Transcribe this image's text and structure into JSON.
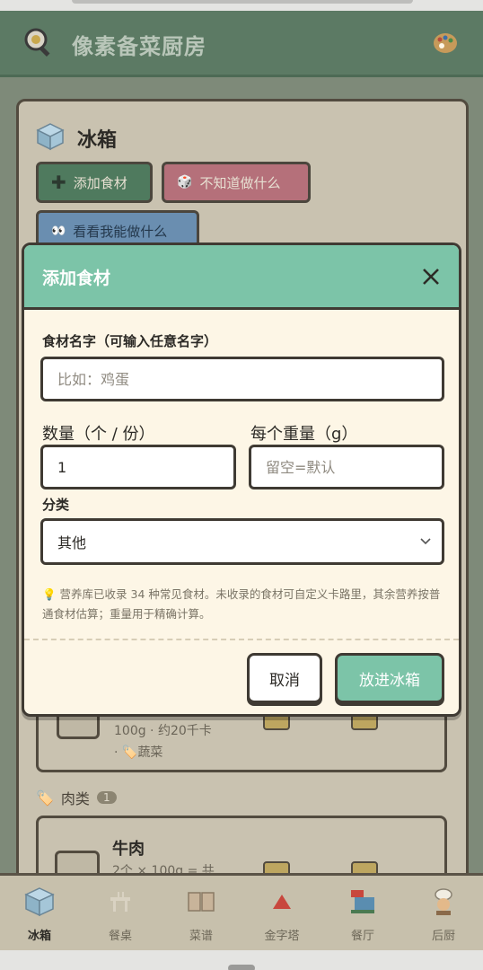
{
  "header": {
    "title": "像素备菜厨房",
    "logo_icon": "frying-pan-icon",
    "settings_icon": "palette-icon"
  },
  "fridge": {
    "title": "冰箱",
    "add_label": "添加食材",
    "random_label": "不知道做什么",
    "see_label": "看看我能做什么"
  },
  "background_list": {
    "veg_item_meta": "100g · 约20千卡",
    "veg_item_tag": "· 🏷️蔬菜",
    "meat_category": "肉类",
    "meat_count": "1",
    "beef_name": "牛肉",
    "beef_meta": "2个 × 100g = 共",
    "beef_qty": "2"
  },
  "modal": {
    "title": "添加食材",
    "name_label": "食材名字（可输入任意名字）",
    "name_placeholder": "比如：鸡蛋",
    "qty_label": "数量（个 / 份）",
    "qty_value": "1",
    "weight_label": "每个重量（g）",
    "weight_placeholder": "留空=默认",
    "category_label": "分类",
    "category_value": "其他",
    "hint": "💡 营养库已收录 34 种常见食材。未收录的食材可自定义卡路里，其余营养按普通食材估算；重量用于精确计算。",
    "cancel_label": "取消",
    "confirm_label": "放进冰箱"
  },
  "nav": [
    {
      "label": "冰箱",
      "icon": "fridge-icon",
      "active": true
    },
    {
      "label": "餐桌",
      "icon": "dining-table-icon",
      "active": false
    },
    {
      "label": "菜谱",
      "icon": "recipe-book-icon",
      "active": false
    },
    {
      "label": "金字塔",
      "icon": "pyramid-icon",
      "active": false
    },
    {
      "label": "餐厅",
      "icon": "restaurant-icon",
      "active": false
    },
    {
      "label": "后厨",
      "icon": "chef-icon",
      "active": false
    }
  ],
  "colors": {
    "modal_header": "#7cc4a8",
    "modal_body": "#fdf6e6",
    "app_header": "#5c7a64"
  }
}
